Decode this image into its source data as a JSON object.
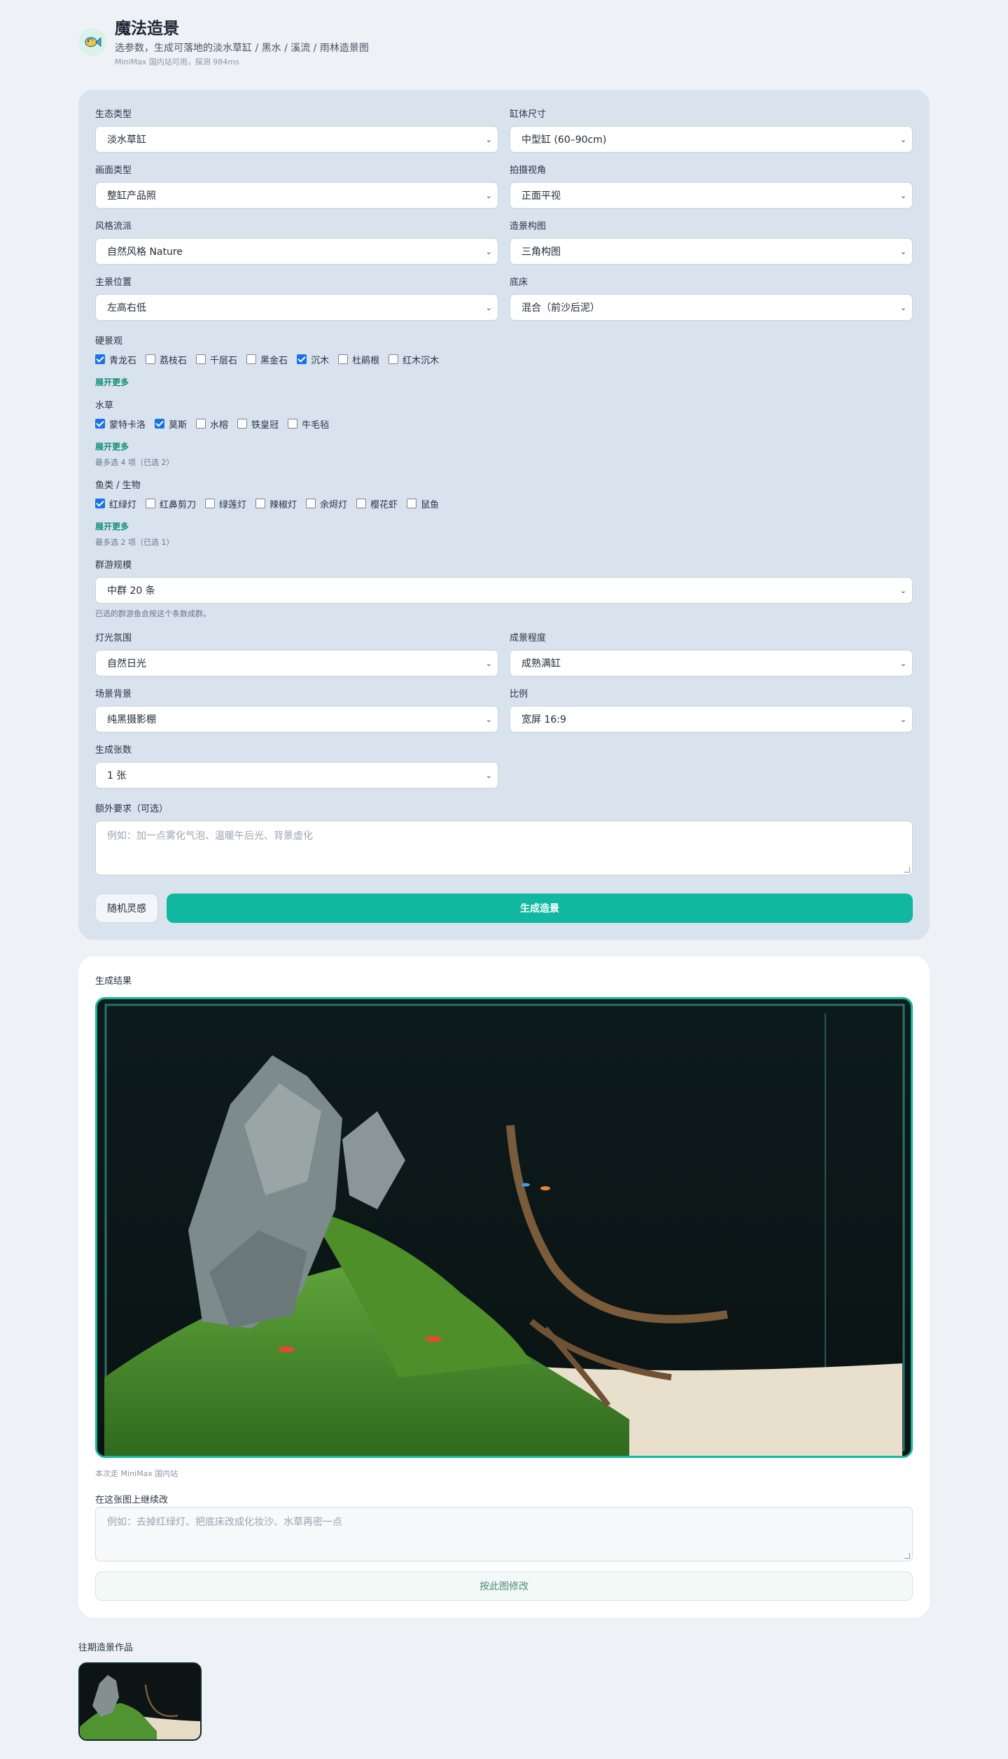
{
  "header": {
    "title": "魔法造景",
    "subtitle": "选参数，生成可落地的淡水草缸 / 黑水 / 溪流 / 雨林造景图",
    "status": "MiniMax 国内站可用，探测 984ms",
    "logo_icon": "fish-icon"
  },
  "form": {
    "ecotype": {
      "label": "生态类型",
      "value": "淡水草缸"
    },
    "tank_size": {
      "label": "缸体尺寸",
      "value": "中型缸 (60–90cm)"
    },
    "image_type": {
      "label": "画面类型",
      "value": "整缸产品照"
    },
    "camera_angle": {
      "label": "拍摄视角",
      "value": "正面平视"
    },
    "style": {
      "label": "风格流派",
      "value": "自然风格 Nature"
    },
    "composition": {
      "label": "造景构图",
      "value": "三角构图"
    },
    "focus_position": {
      "label": "主景位置",
      "value": "左高右低"
    },
    "substrate": {
      "label": "底床",
      "value": "混合（前沙后泥）"
    },
    "hardscape": {
      "label": "硬景观",
      "options": [
        {
          "label": "青龙石",
          "checked": true
        },
        {
          "label": "荔枝石",
          "checked": false
        },
        {
          "label": "千层石",
          "checked": false
        },
        {
          "label": "黑金石",
          "checked": false
        },
        {
          "label": "沉木",
          "checked": true
        },
        {
          "label": "杜鹃根",
          "checked": false
        },
        {
          "label": "红木沉木",
          "checked": false
        }
      ],
      "more": "展开更多"
    },
    "plants": {
      "label": "水草",
      "options": [
        {
          "label": "蒙特卡洛",
          "checked": true
        },
        {
          "label": "莫斯",
          "checked": true
        },
        {
          "label": "水榕",
          "checked": false
        },
        {
          "label": "铁皇冠",
          "checked": false
        },
        {
          "label": "牛毛毡",
          "checked": false
        }
      ],
      "more": "展开更多",
      "hint": "最多选 4 项（已选 2）"
    },
    "fauna": {
      "label": "鱼类 / 生物",
      "options": [
        {
          "label": "红绿灯",
          "checked": true
        },
        {
          "label": "红鼻剪刀",
          "checked": false
        },
        {
          "label": "绿莲灯",
          "checked": false
        },
        {
          "label": "辣椒灯",
          "checked": false
        },
        {
          "label": "余烬灯",
          "checked": false
        },
        {
          "label": "樱花虾",
          "checked": false
        },
        {
          "label": "鼠鱼",
          "checked": false
        }
      ],
      "more": "展开更多",
      "hint": "最多选 2 项（已选 1）"
    },
    "school_size": {
      "label": "群游规模",
      "value": "中群 20 条",
      "hint": "已选的群游鱼会按这个条数成群。"
    },
    "lighting": {
      "label": "灯光氛围",
      "value": "自然日光"
    },
    "maturity": {
      "label": "成景程度",
      "value": "成熟满缸"
    },
    "background": {
      "label": "场景背景",
      "value": "纯黑摄影棚"
    },
    "ratio": {
      "label": "比例",
      "value": "宽屏 16:9"
    },
    "count": {
      "label": "生成张数",
      "value": "1 张"
    },
    "extra": {
      "label": "额外要求（可选）",
      "placeholder": "例如：加一点雾化气泡、温暖午后光、背景虚化"
    },
    "random_button": "随机灵感",
    "generate_button": "生成造景"
  },
  "result": {
    "title": "生成结果",
    "provider_note": "本次走 MiniMax 国内站",
    "edit_label": "在这张图上继续改",
    "edit_placeholder": "例如：去掉红绿灯、把底床改成化妆沙、水草再密一点",
    "edit_button": "按此图修改"
  },
  "history": {
    "label": "往期造景作品"
  },
  "colors": {
    "accent": "#10b8a0",
    "link": "#0f8f74",
    "checkbox": "#1a73e8",
    "page_bg": "#eef2f7",
    "form_bg": "#d8e3ee"
  }
}
